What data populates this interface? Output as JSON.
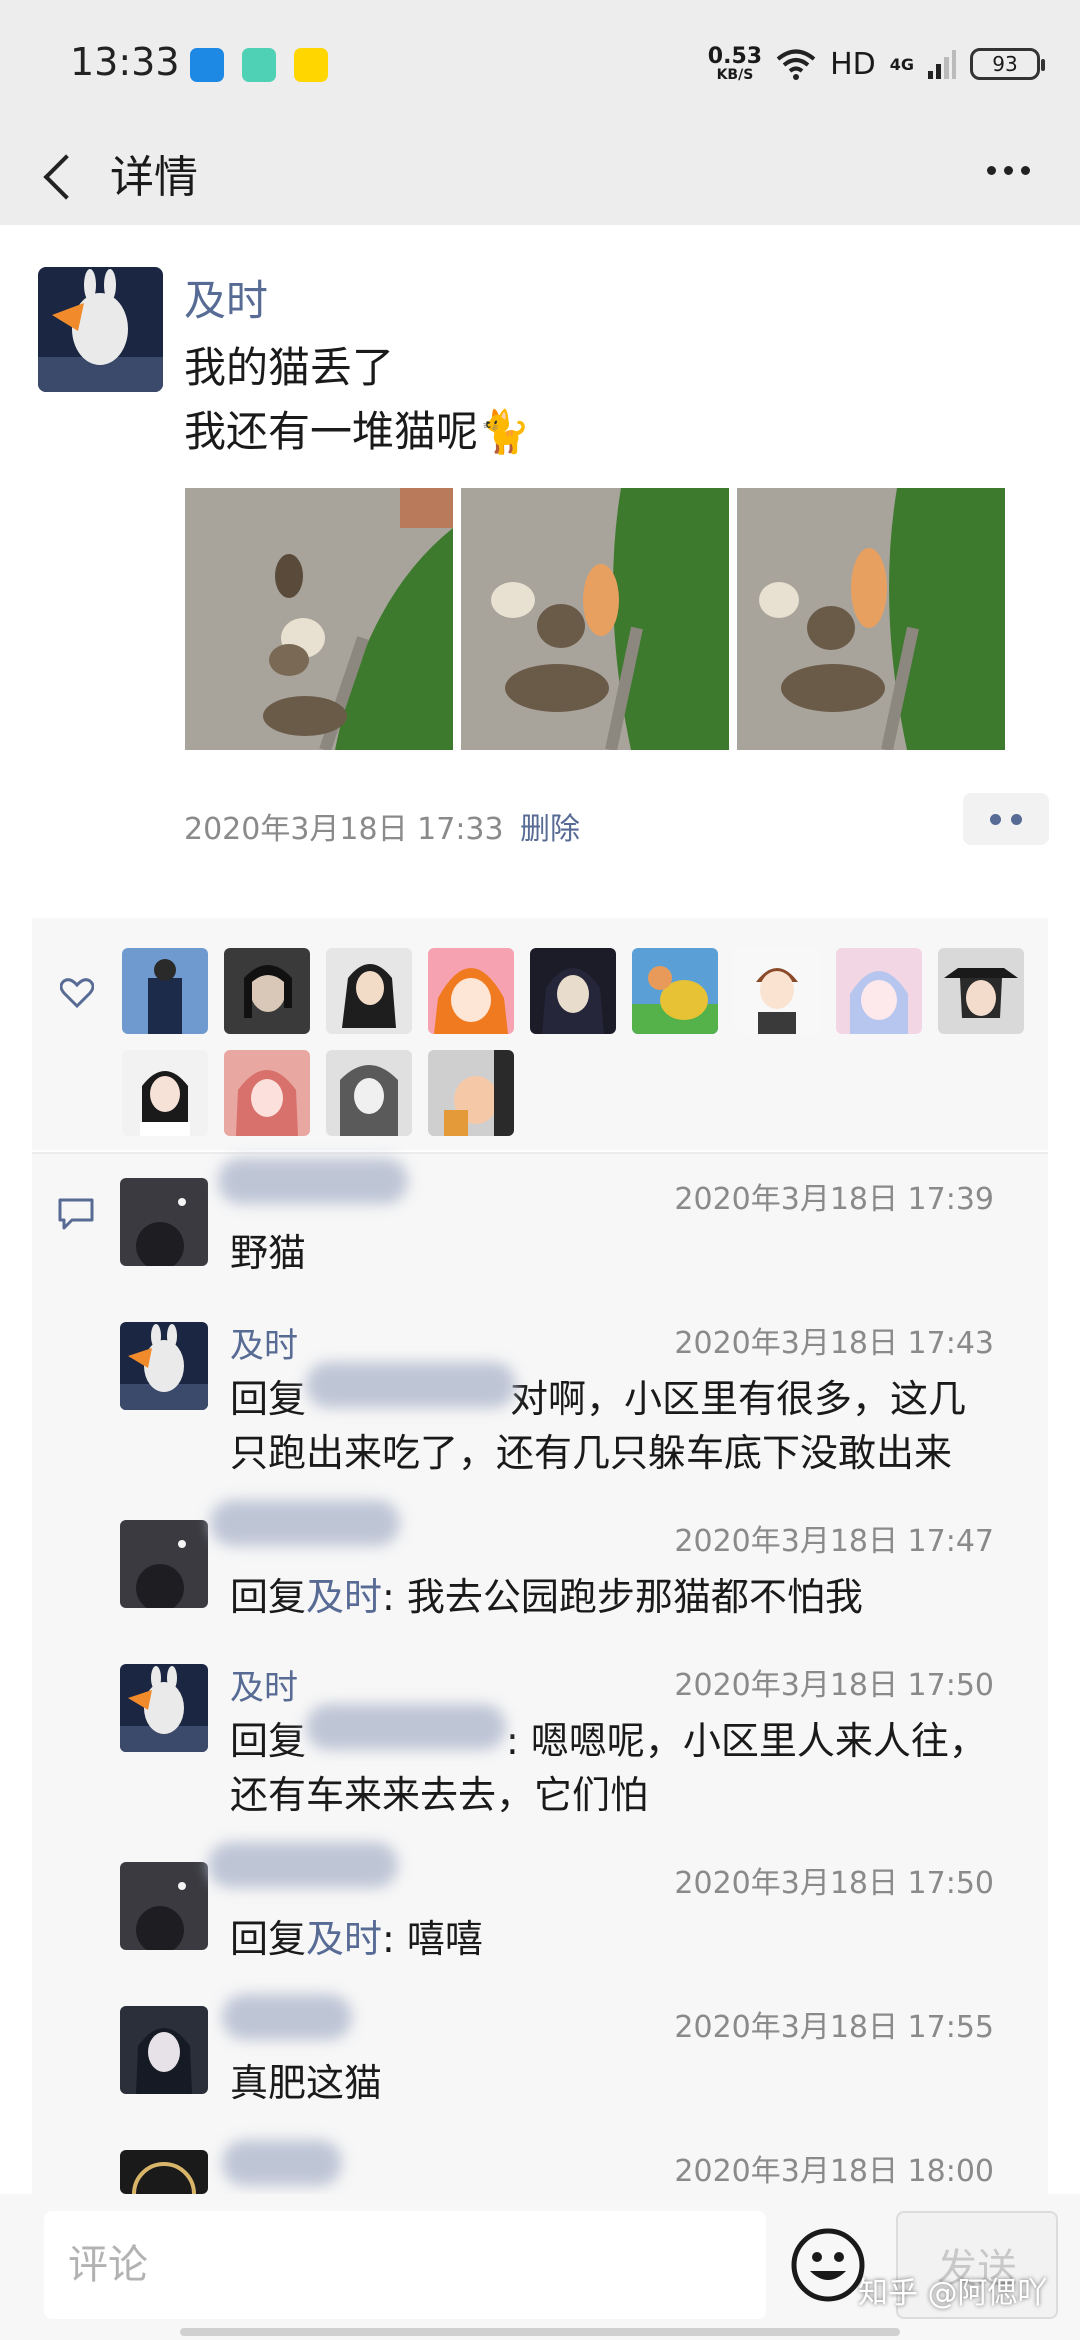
{
  "status_bar": {
    "time": "13:33",
    "net_speed": "0.53",
    "net_unit": "KB/S",
    "hd": "HD",
    "network_type": "4G",
    "battery": "93"
  },
  "nav": {
    "title": "详情"
  },
  "post": {
    "author": "及时",
    "lines": [
      "我的猫丢了",
      "我还有一堆猫呢🐈"
    ],
    "time": "2020年3月18日 17:33",
    "delete_label": "删除"
  },
  "likes": {
    "count_shown": 13
  },
  "comments": [
    {
      "author": "",
      "time": "2020年3月18日 17:39",
      "text": "野猫"
    },
    {
      "author": "及时",
      "time": "2020年3月18日 17:43",
      "reply_prefix": "回复",
      "line1_rest": "对啊，小区里有很多，这几",
      "line2": "只跑出来吃了，还有几只躲车底下没敢出来"
    },
    {
      "author": "",
      "time": "2020年3月18日 17:47",
      "reply_prefix": "回复",
      "reply_to": "及时",
      "text": ": 我去公园跑步那猫都不怕我"
    },
    {
      "author": "及时",
      "time": "2020年3月18日 17:50",
      "reply_prefix": "回复",
      "line1_rest": ": 嗯嗯呢，小区里人来人往，",
      "line2": "还有车来来去去，它们怕"
    },
    {
      "author": "",
      "time": "2020年3月18日 17:50",
      "reply_prefix": "回复",
      "reply_to": "及时",
      "text": ": 嘻嘻"
    },
    {
      "author": "",
      "time": "2020年3月18日 17:55",
      "text": "真肥这猫"
    },
    {
      "author": "",
      "time": "2020年3月18日 18:00",
      "text": ""
    }
  ],
  "input": {
    "placeholder": "评论",
    "send_label": "发送"
  },
  "watermark": "知乎 @阿偲吖"
}
